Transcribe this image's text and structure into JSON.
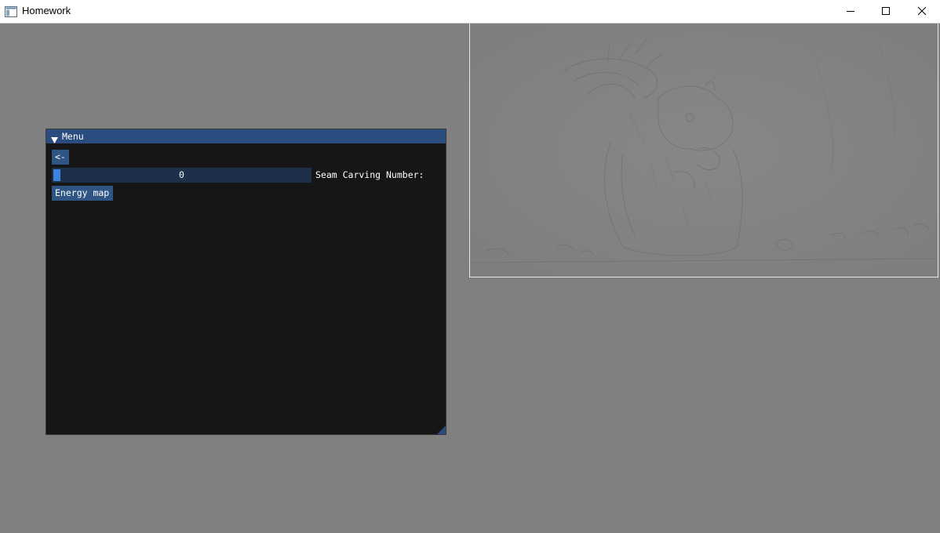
{
  "window": {
    "title": "Homework"
  },
  "imgui": {
    "title": "Menu",
    "back_label": "<-",
    "slider_value": "0",
    "slider_label": "Seam Carving Number:",
    "energy_label": "Energy map"
  },
  "colors": {
    "background": "#808080",
    "imgui_bg": "#161616",
    "imgui_title": "#2a4c7f",
    "button": "#2f5584",
    "slider_bg": "#1e2f4a",
    "slider_grab": "#3d84e0"
  },
  "icons": {
    "app": "app-window-icon",
    "minimize": "minimize-icon",
    "maximize": "maximize-icon",
    "close": "close-icon",
    "collapse": "collapse-arrow-icon"
  }
}
